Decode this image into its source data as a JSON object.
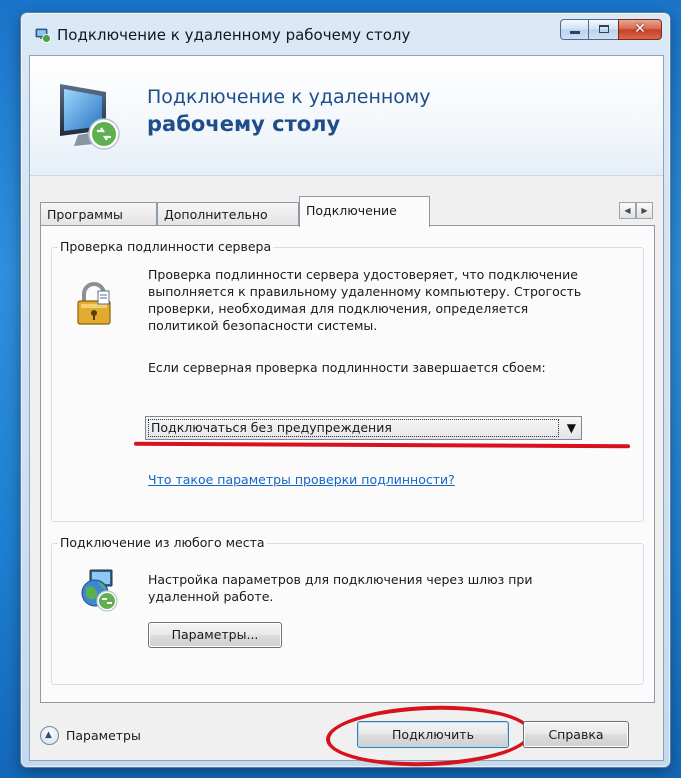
{
  "window": {
    "title": "Подключение к удаленному рабочему столу",
    "buttons": [
      "minimize-icon",
      "maximize-icon",
      "close-icon"
    ]
  },
  "banner": {
    "line1": "Подключение к удаленному",
    "line2": "рабочему столу"
  },
  "tabs": [
    {
      "label": "Программы",
      "active": false
    },
    {
      "label": "Дополнительно",
      "active": false
    },
    {
      "label": "Подключение",
      "active": true
    }
  ],
  "server_auth": {
    "group_title": "Проверка подлинности сервера",
    "description": "Проверка подлинности сервера удостоверяет, что подключение выполняется к правильному удаленному компьютеру. Строгость проверки, необходимая для подключения, определяется политикой безопасности системы.",
    "fail_label": "Если серверная проверка подлинности завершается сбоем:",
    "fail_option": "Подключаться без предупреждения",
    "help_link": "Что такое параметры проверки подлинности?"
  },
  "gateway": {
    "group_title": "Подключение из любого места",
    "description": "Настройка параметров для подключения через шлюз при удаленной работе.",
    "settings_button": "Параметры..."
  },
  "footer": {
    "options_label": "Параметры",
    "connect_button": "Подключить",
    "help_button": "Справка"
  },
  "colors": {
    "link": "#1566c9",
    "annotation_red": "#d8121c",
    "banner_text": "#1f4d8a"
  }
}
